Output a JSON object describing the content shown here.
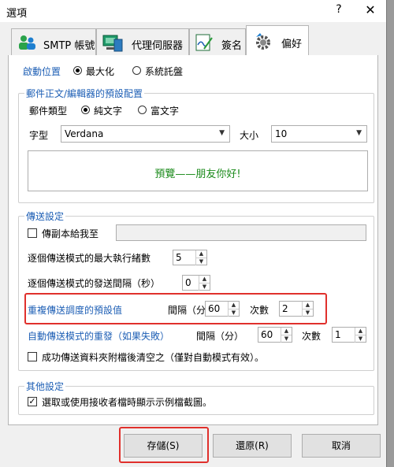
{
  "window": {
    "title": "選項",
    "help": "?",
    "close": "✕"
  },
  "tabs": [
    {
      "label": "SMTP 帳號",
      "icon": "users-icon"
    },
    {
      "label": "代理伺服器",
      "icon": "server-icon"
    },
    {
      "label": "簽名",
      "icon": "signature-icon"
    },
    {
      "label": "偏好",
      "icon": "gear-icon"
    }
  ],
  "startup": {
    "label": "啟動位置",
    "option_max": "最大化",
    "option_tray": "系統託盤"
  },
  "editor": {
    "legend": "郵件正文/編輯器的預設配置",
    "mail_type_label": "郵件類型",
    "plain": "純文字",
    "rich": "富文字",
    "font_label": "字型",
    "font_value": "Verdana",
    "size_label": "大小",
    "size_value": "10",
    "preview": "預覽——朋友你好!"
  },
  "send": {
    "legend": "傳送設定",
    "bcc_label": "傳副本給我至",
    "max_threads_label": "逐個傳送模式的最大執行緒數",
    "max_threads": "5",
    "interval_label": "逐個傳送模式的發送間隔（秒）",
    "interval": "0",
    "schedule_label": "重複傳送調度的預設值",
    "schedule_interval_label": "間隔（分）",
    "schedule_interval": "60",
    "schedule_count_label": "次數",
    "schedule_count": "2",
    "retry_label": "自動傳送模式的重發（如果失敗）",
    "retry_interval_label": "間隔（分）",
    "retry_interval": "60",
    "retry_count_label": "次數",
    "retry_count": "1",
    "clear_attach_label": "成功傳送資料夾附檔後清空之（僅對自動模式有效）。"
  },
  "other": {
    "legend": "其他設定",
    "screenshot_label": "選取或使用接收者檔時顯示示例檔截圖。"
  },
  "buttons": {
    "save": "存儲(S)",
    "restore": "還原(R)",
    "cancel": "取消"
  },
  "colors": {
    "accent": "#1e5fb5",
    "highlight": "#e0302c",
    "preview_text": "#1a8a1a"
  }
}
